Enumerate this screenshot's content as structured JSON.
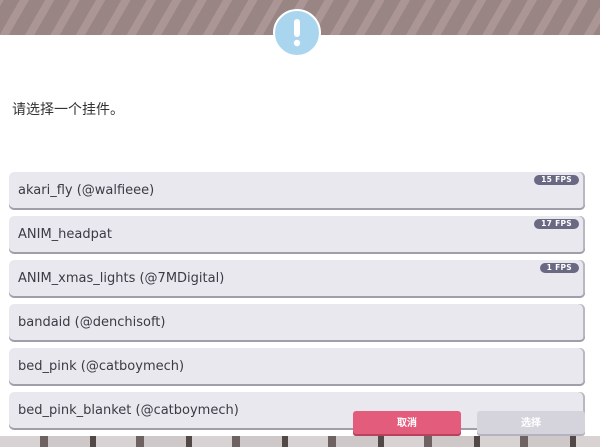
{
  "dialog": {
    "prompt": "请选择一个挂件。",
    "icon": "exclamation-icon",
    "accent_color": "#a9d6ee"
  },
  "items": [
    {
      "label": "akari_fly (@walfieee)",
      "fps": "15 FPS"
    },
    {
      "label": "ANIM_headpat",
      "fps": "17 FPS"
    },
    {
      "label": "ANIM_xmas_lights (@7MDigital)",
      "fps": "1 FPS"
    },
    {
      "label": "bandaid (@denchisoft)",
      "fps": ""
    },
    {
      "label": "bed_pink (@catboymech)",
      "fps": ""
    },
    {
      "label": "bed_pink_blanket (@catboymech)",
      "fps": ""
    }
  ],
  "buttons": {
    "cancel_label": "取消",
    "select_label": "选择",
    "cancel_color": "#e35c7c",
    "select_color": "#d5d4dd"
  }
}
